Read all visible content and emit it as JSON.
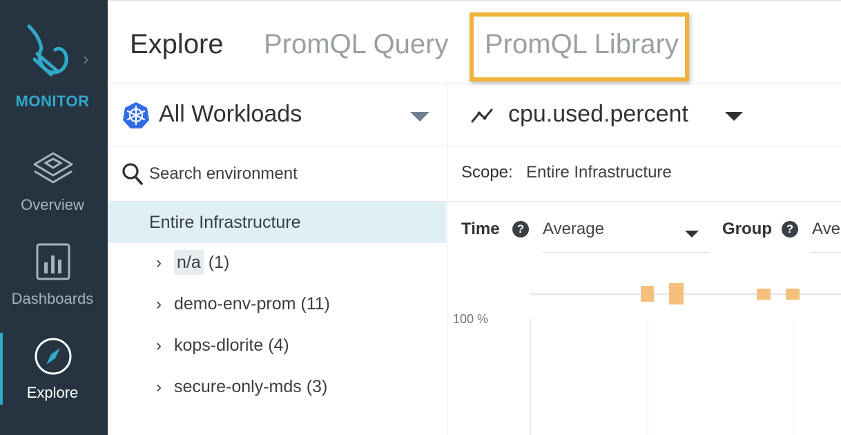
{
  "brand": {
    "name": "MONITOR"
  },
  "rail": {
    "items": [
      {
        "label": "Overview",
        "icon": "layers-icon",
        "active": false
      },
      {
        "label": "Dashboards",
        "icon": "bar-chart-icon",
        "active": false
      },
      {
        "label": "Explore",
        "icon": "compass-icon",
        "active": true
      }
    ]
  },
  "tabs": [
    {
      "label": "Explore",
      "active": true
    },
    {
      "label": "PromQL Query",
      "active": false
    },
    {
      "label": "PromQL Library",
      "active": false,
      "highlighted": true
    }
  ],
  "left": {
    "selector": {
      "label": "All Workloads",
      "icon": "kubernetes-icon"
    },
    "search": {
      "placeholder": "Search environment"
    },
    "tree": {
      "root": "Entire Infrastructure",
      "items": [
        {
          "name": "n/a",
          "count": "(1)"
        },
        {
          "name": "demo-env-prom",
          "count": "(11)"
        },
        {
          "name": "kops-dlorite",
          "count": "(4)"
        },
        {
          "name": "secure-only-mds",
          "count": "(3)"
        }
      ]
    }
  },
  "right": {
    "metric": {
      "label": "cpu.used.percent",
      "icon": "line-chart-icon"
    },
    "scope": {
      "label": "Scope:",
      "value": "Entire Infrastructure"
    },
    "time": {
      "label": "Time",
      "value": "Average"
    },
    "group": {
      "label": "Group",
      "value": "Ave"
    },
    "chart": {
      "y_tick": "100 %"
    }
  },
  "colors": {
    "rail_bg": "#263442",
    "accent": "#31a9c9",
    "highlight": "#f0b33a",
    "bar": "#f5c07e",
    "selected_row": "#dff0f4"
  }
}
